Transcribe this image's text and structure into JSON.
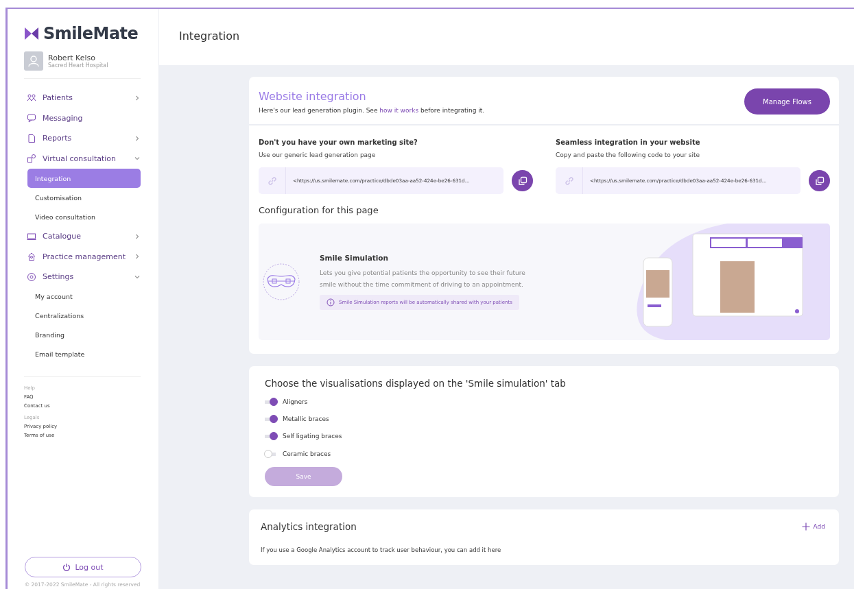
{
  "brand": {
    "name": "SmileMate"
  },
  "user": {
    "name": "Robert Kelso",
    "organization": "Sacred Heart Hospital"
  },
  "sidebar": {
    "items": [
      {
        "label": "Patients",
        "expanded": false
      },
      {
        "label": "Messaging"
      },
      {
        "label": "Reports",
        "expanded": false
      },
      {
        "label": "Virtual consultation",
        "expanded": true,
        "children": [
          {
            "label": "Integration",
            "selected": true
          },
          {
            "label": "Customisation",
            "selected": false
          },
          {
            "label": "Video consultation",
            "selected": false
          }
        ]
      },
      {
        "label": "Catalogue",
        "expanded": false
      },
      {
        "label": "Practice management",
        "expanded": false
      },
      {
        "label": "Settings",
        "expanded": true,
        "children": [
          {
            "label": "My account",
            "selected": false
          },
          {
            "label": "Centralizations",
            "selected": false
          },
          {
            "label": "Branding",
            "selected": false
          },
          {
            "label": "Email template",
            "selected": false
          }
        ]
      }
    ],
    "footer_groups": [
      {
        "heading": "Help",
        "links": [
          "FAQ",
          "Contact us"
        ]
      },
      {
        "heading": "Legals",
        "links": [
          "Privacy policy",
          "Terms of use"
        ]
      }
    ],
    "logout": "Log out",
    "copyright": "© 2017-2022 SmileMate - All rights reserved"
  },
  "page": {
    "title": "Integration"
  },
  "website_integration": {
    "title": "Website integration",
    "subtitle_before": "Here's our lead generation plugin. See ",
    "subtitle_link": "how it works",
    "subtitle_after": " before integrating it.",
    "button": "Manage Flows",
    "options": [
      {
        "heading": "Don't you have your own marketing site?",
        "description": "Use our generic lead generation page",
        "code": "<https://us.smilemate.com/practice/dbde03aa-aa52-424e-be26-631d..."
      },
      {
        "heading": "Seamless integration in your website",
        "description": "Copy and paste the following code to your site",
        "code": "<https://us.smilemate.com/practice/dbde03aa-aa52-424e-be26-631d..."
      }
    ],
    "configuration": {
      "title": "Configuration for this page",
      "feature_title": "Smile Simulation",
      "feature_description": "Lets you give potential patients the opportunity to see their future smile without  the time commitment of driving to an appointment.",
      "info": "Smile Simulation reports will be automatically shared with your patients"
    }
  },
  "visualisations": {
    "title": "Choose the visualisations displayed on the 'Smile simulation' tab",
    "toggles": [
      {
        "label": "Aligners",
        "on": true
      },
      {
        "label": "Metallic braces",
        "on": true
      },
      {
        "label": "Self ligating braces",
        "on": true
      },
      {
        "label": "Ceramic braces",
        "on": false
      }
    ],
    "save": {
      "label": "Save",
      "disabled": true
    }
  },
  "analytics": {
    "title": "Analytics integration",
    "add": "Add",
    "description": "If you use a Google Analytics account to track user behaviour, you can add it here"
  }
}
